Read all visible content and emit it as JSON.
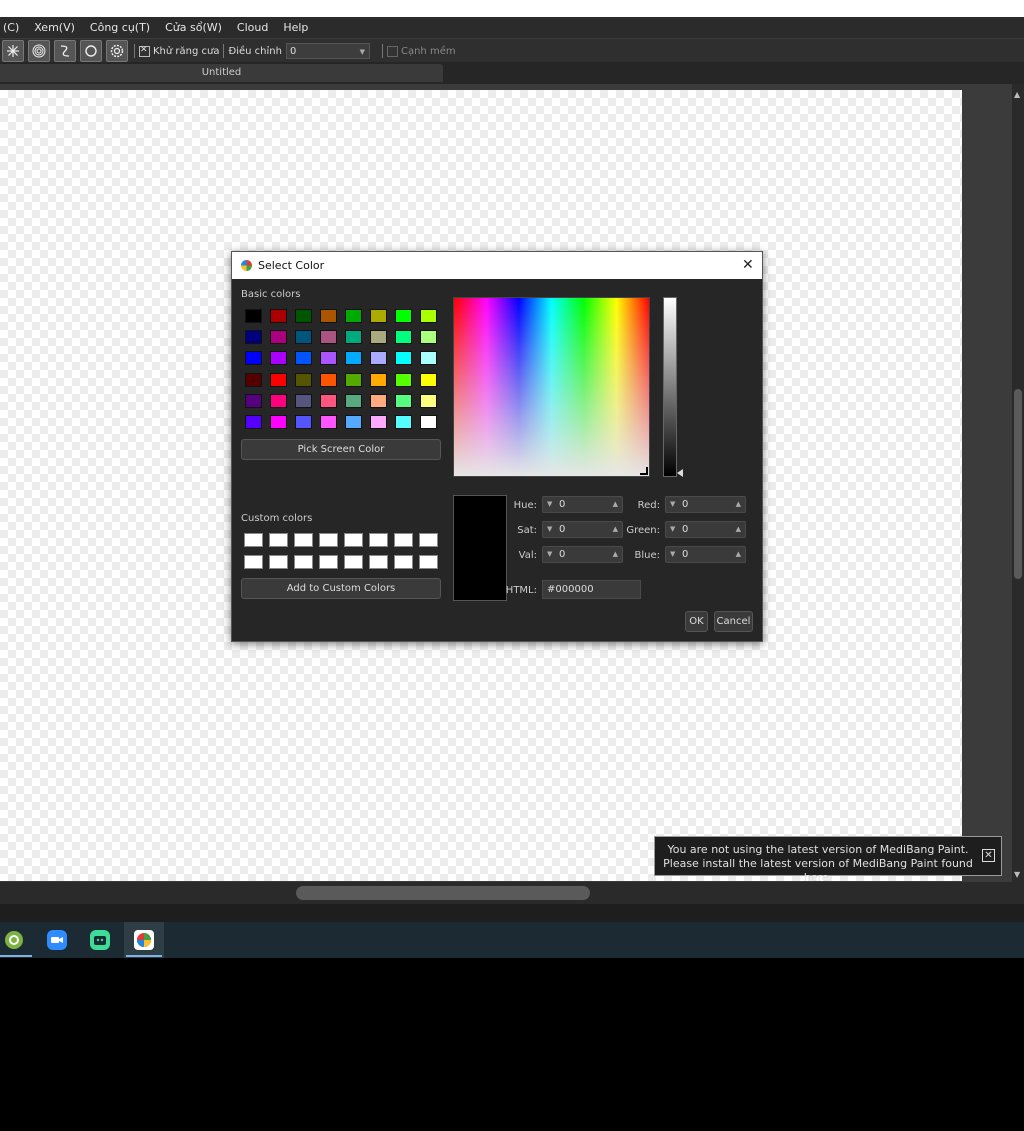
{
  "menu": [
    "(C)",
    "Xem(V)",
    "Công cụ(T)",
    "Cửa sổ(W)",
    "Cloud",
    "Help"
  ],
  "toolbar": {
    "antialias_label": "Khử răng cưa",
    "adjust_label": "Điều chỉnh",
    "adjust_value": "0",
    "soft_edge_label": "Cạnh mềm"
  },
  "tab": {
    "title": "Untitled"
  },
  "dialog": {
    "title": "Select Color",
    "basic_colors_label": "Basic colors",
    "custom_colors_label": "Custom colors",
    "pick_screen_label": "Pick Screen Color",
    "add_custom_label": "Add to Custom Colors",
    "ok_label": "OK",
    "cancel_label": "Cancel",
    "html_label": "HTML:",
    "html_value": "#000000",
    "fields": [
      {
        "label": "Hue:",
        "value": "0"
      },
      {
        "label": "Sat:",
        "value": "0"
      },
      {
        "label": "Val:",
        "value": "0"
      },
      {
        "label": "Red:",
        "value": "0"
      },
      {
        "label": "Green:",
        "value": "0"
      },
      {
        "label": "Blue:",
        "value": "0"
      }
    ],
    "basic_colors": [
      [
        "#000000",
        "#aa0000",
        "#005500",
        "#aa5500",
        "#00aa00",
        "#aaaa00",
        "#00ff00",
        "#aaff00"
      ],
      [
        "#00007f",
        "#aa007f",
        "#00557f",
        "#aa557f",
        "#00aa7f",
        "#aaaa7f",
        "#00ff7f",
        "#aaff7f"
      ],
      [
        "#0000ff",
        "#aa00ff",
        "#0055ff",
        "#aa55ff",
        "#00aaff",
        "#aaaaff",
        "#00ffff",
        "#aaffff"
      ],
      [
        "#550000",
        "#ff0000",
        "#555500",
        "#ff5500",
        "#55aa00",
        "#ffaa00",
        "#55ff00",
        "#ffff00"
      ],
      [
        "#55007f",
        "#ff007f",
        "#55557f",
        "#ff557f",
        "#55aa7f",
        "#ffaa7f",
        "#55ff7f",
        "#ffff7f"
      ],
      [
        "#5500ff",
        "#ff00ff",
        "#5555ff",
        "#ff55ff",
        "#55aaff",
        "#ffaaff",
        "#55ffff",
        "#ffffff"
      ]
    ],
    "current_color": "#000000"
  },
  "notice": {
    "line1": "You are not using the latest version of MediBang Paint.",
    "line2": "Please install the latest version of MediBang Paint found here."
  },
  "taskbar": [
    "app-icon-green",
    "zoom-icon",
    "discord-like-icon",
    "medibang-icon"
  ]
}
